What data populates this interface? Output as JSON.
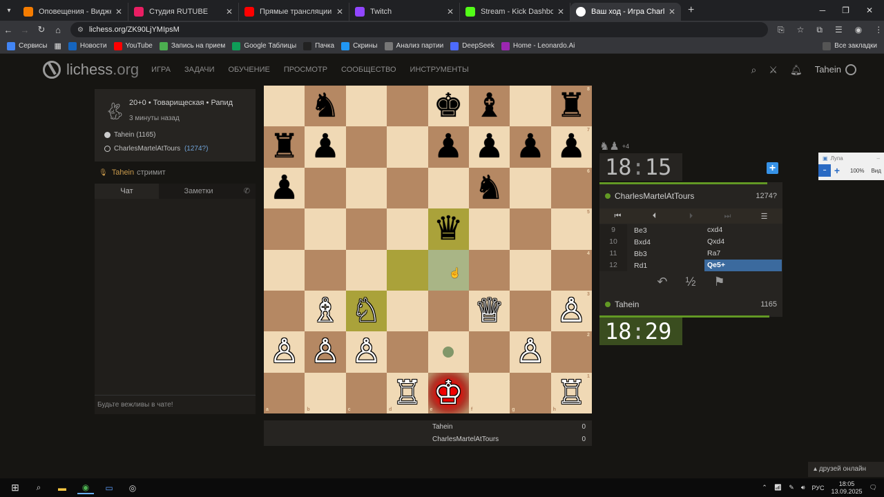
{
  "browser": {
    "tabs": [
      {
        "title": "Оповещения - Виджеты - Don",
        "color": "#f57c00"
      },
      {
        "title": "Студия RUTUBE",
        "color": "#e91e63"
      },
      {
        "title": "Прямые трансляции - YouTub",
        "color": "#ff0000"
      },
      {
        "title": "Twitch",
        "color": "#9146ff"
      },
      {
        "title": "Stream - Kick Dashboard",
        "color": "#53fc18"
      },
      {
        "title": "Ваш ход - Игра CharlesMartelA",
        "color": "#ffffff",
        "active": true
      }
    ],
    "url": "lichess.org/ZK90LjYMIpsM",
    "bookmarks": [
      "Сервисы",
      "Новости",
      "YouTube",
      "Запись на прием",
      "Google Таблицы",
      "Пачка",
      "Скрины",
      "Анализ партии",
      "DeepSeek",
      "Home - Leonardo.Ai"
    ],
    "all_bookmarks": "Все закладки"
  },
  "lichess": {
    "logo": "lichess",
    "logo_tld": ".org",
    "nav": [
      "ИГРА",
      "ЗАДАЧИ",
      "ОБУЧЕНИЕ",
      "ПРОСМОТР",
      "СООБЩЕСТВО",
      "ИНСТРУМЕНТЫ"
    ],
    "username": "Tahein"
  },
  "game": {
    "title": "20+0 • Товарищеская • Рапид",
    "ago": "3 минуты назад",
    "white": {
      "name": "Tahein",
      "rating": "(1165)"
    },
    "black": {
      "name": "CharlesMartelAtTours",
      "rating": "(1274?)"
    },
    "streamer": "Tahein",
    "streaming": "стримит"
  },
  "chat": {
    "tab_chat": "Чат",
    "tab_notes": "Заметки",
    "placeholder": "Будьте вежливы в чате!"
  },
  "board": {
    "files": [
      "a",
      "b",
      "c",
      "d",
      "e",
      "f",
      "g",
      "h"
    ],
    "ranks": [
      "8",
      "7",
      "6",
      "5",
      "4",
      "3",
      "2",
      "1"
    ],
    "pieces": [
      {
        "sq": "b8",
        "p": "♞",
        "c": "b"
      },
      {
        "sq": "e8",
        "p": "♚",
        "c": "b"
      },
      {
        "sq": "f8",
        "p": "♝",
        "c": "b"
      },
      {
        "sq": "h8",
        "p": "♜",
        "c": "b"
      },
      {
        "sq": "a7",
        "p": "♜",
        "c": "b"
      },
      {
        "sq": "b7",
        "p": "♟",
        "c": "b"
      },
      {
        "sq": "e7",
        "p": "♟",
        "c": "b"
      },
      {
        "sq": "f7",
        "p": "♟",
        "c": "b"
      },
      {
        "sq": "g7",
        "p": "♟",
        "c": "b"
      },
      {
        "sq": "h7",
        "p": "♟",
        "c": "b"
      },
      {
        "sq": "a6",
        "p": "♟",
        "c": "b"
      },
      {
        "sq": "f6",
        "p": "♞",
        "c": "b"
      },
      {
        "sq": "e5",
        "p": "♛",
        "c": "b"
      },
      {
        "sq": "b3",
        "p": "♗",
        "c": "w"
      },
      {
        "sq": "c3",
        "p": "♘",
        "c": "w"
      },
      {
        "sq": "f3",
        "p": "♕",
        "c": "w"
      },
      {
        "sq": "h3",
        "p": "♙",
        "c": "w"
      },
      {
        "sq": "a2",
        "p": "♙",
        "c": "w"
      },
      {
        "sq": "b2",
        "p": "♙",
        "c": "w"
      },
      {
        "sq": "c2",
        "p": "♙",
        "c": "w"
      },
      {
        "sq": "g2",
        "p": "♙",
        "c": "w"
      },
      {
        "sq": "d1",
        "p": "♖",
        "c": "w"
      },
      {
        "sq": "e1",
        "p": "♔",
        "c": "w"
      },
      {
        "sq": "h1",
        "p": "♖",
        "c": "w"
      }
    ],
    "last_move": [
      "d4",
      "e5"
    ],
    "selected": "c3",
    "hover": "e4",
    "check": "e1",
    "dest": "e2"
  },
  "clocks": {
    "top": {
      "min": "18",
      "sec": "15"
    },
    "bottom": {
      "min": "18",
      "sec": "29"
    }
  },
  "material": {
    "diff": "+4"
  },
  "moves": [
    {
      "n": "9",
      "w": "Be3",
      "b": "cxd4"
    },
    {
      "n": "10",
      "w": "Bxd4",
      "b": "Qxd4"
    },
    {
      "n": "11",
      "w": "Bb3",
      "b": "Ra7"
    },
    {
      "n": "12",
      "w": "Rd1",
      "b": "Qe5+",
      "current": true
    }
  ],
  "panel": {
    "top_player": "CharlesMartelAtTours",
    "top_rating": "1274?",
    "bottom_player": "Tahein",
    "bottom_rating": "1165",
    "draw": "½"
  },
  "scores": [
    {
      "name": "Tahein",
      "value": "0"
    },
    {
      "name": "CharlesMartelAtTours",
      "value": "0"
    }
  ],
  "magnifier": {
    "title": "Лупа",
    "zoom": "100%",
    "view": "Вид"
  },
  "friends": "друзей онлайн",
  "taskbar": {
    "lang": "РУС",
    "time": "18:05",
    "date": "13.09.2025"
  }
}
